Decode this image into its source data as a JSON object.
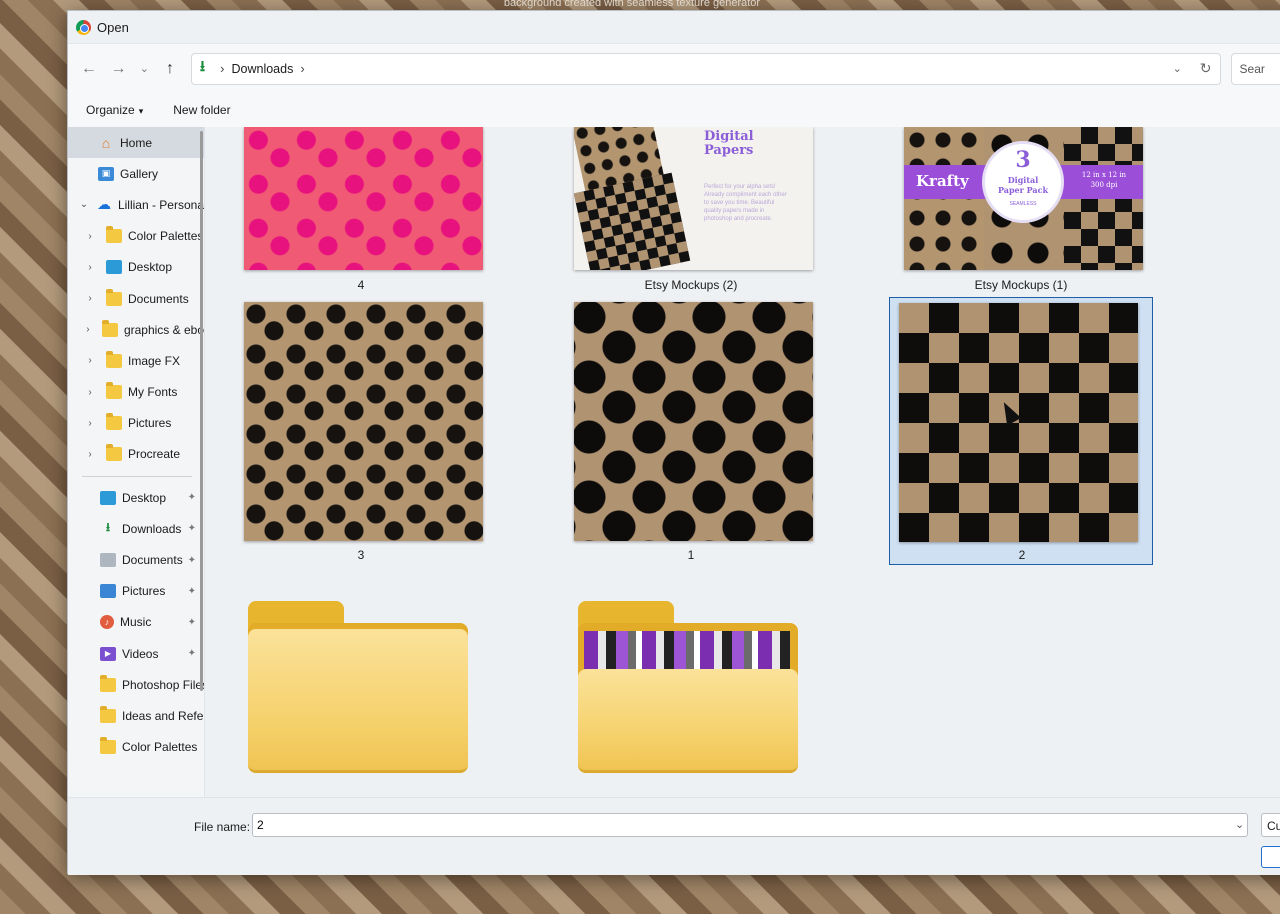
{
  "background_caption": "background created with seamless texture generator",
  "window": {
    "title": "Open"
  },
  "nav": {
    "back": "←",
    "forward": "→",
    "recent": "⌄",
    "up": "↑"
  },
  "address": {
    "icon": "download-icon",
    "path": [
      "Downloads"
    ],
    "separator": "›",
    "dropdown": "⌄",
    "refresh": "↻"
  },
  "search": {
    "placeholder": "Sear"
  },
  "toolbar": {
    "organize": "Organize",
    "organize_caret": "▾",
    "new_folder": "New folder"
  },
  "sidebar": {
    "items": [
      {
        "label": "Home",
        "icon": "home-icon",
        "indent": 0,
        "expander": "",
        "active": true
      },
      {
        "label": "Gallery",
        "icon": "gallery-icon",
        "indent": 0,
        "expander": ""
      },
      {
        "label": "Lillian - Persona",
        "icon": "onedrive-cloud-icon",
        "indent": 0,
        "expander": "⌄"
      },
      {
        "label": "Color Palettes",
        "icon": "folder-icon",
        "indent": 1,
        "expander": "›"
      },
      {
        "label": "Desktop",
        "icon": "desktop-icon",
        "indent": 1,
        "expander": "›"
      },
      {
        "label": "Documents",
        "icon": "folder-icon",
        "indent": 1,
        "expander": "›"
      },
      {
        "label": "graphics & ebo",
        "icon": "folder-icon",
        "indent": 1,
        "expander": "›"
      },
      {
        "label": "Image FX",
        "icon": "folder-icon",
        "indent": 1,
        "expander": "›"
      },
      {
        "label": "My Fonts",
        "icon": "folder-icon",
        "indent": 1,
        "expander": "›"
      },
      {
        "label": "Pictures",
        "icon": "folder-icon",
        "indent": 1,
        "expander": "›"
      },
      {
        "label": "Procreate",
        "icon": "folder-icon",
        "indent": 1,
        "expander": "›"
      }
    ],
    "quick_access": [
      {
        "label": "Desktop",
        "icon": "desktop-icon",
        "pinned": true
      },
      {
        "label": "Downloads",
        "icon": "download-icon",
        "pinned": true
      },
      {
        "label": "Documents",
        "icon": "documents-icon",
        "pinned": true
      },
      {
        "label": "Pictures",
        "icon": "pictures-icon",
        "pinned": true
      },
      {
        "label": "Music",
        "icon": "music-icon",
        "pinned": true
      },
      {
        "label": "Videos",
        "icon": "videos-icon",
        "pinned": true
      },
      {
        "label": "Photoshop Files",
        "icon": "folder-icon",
        "pinned": false
      },
      {
        "label": "Ideas and Refere",
        "icon": "folder-icon",
        "pinned": false
      },
      {
        "label": "Color Palettes",
        "icon": "folder-icon",
        "pinned": false
      }
    ],
    "pin_glyph": "📌"
  },
  "files": [
    {
      "name": "4",
      "kind": "image",
      "thumbnail": "pink-squiggle-pattern"
    },
    {
      "name": "Etsy Mockups (2)",
      "kind": "image",
      "thumbnail": "digital-papers-mockup",
      "thumb_text": {
        "title_line1": "Digital",
        "title_line2": "Papers",
        "blurb": "Perfect for your alpha sets! Already compliment each other to save you time. Beautiful quality papers made in photoshop and procreate."
      }
    },
    {
      "name": "Etsy Mockups (1)",
      "kind": "image",
      "thumbnail": "krafty-paper-pack-mockup",
      "thumb_text": {
        "brand": "Krafty",
        "number": "3",
        "pack_line1": "Digital",
        "pack_line2": "Paper Pack",
        "seamless": "SEAMLESS",
        "size_line1": "12 in x 12 in",
        "size_line2": "300 dpi"
      }
    },
    {
      "name": "3",
      "kind": "image",
      "thumbnail": "brown-leopard-pattern"
    },
    {
      "name": "1",
      "kind": "image",
      "thumbnail": "brown-polka-dot-pattern"
    },
    {
      "name": "2",
      "kind": "image",
      "thumbnail": "brown-checker-pattern",
      "selected": true
    },
    {
      "name": "",
      "kind": "folder",
      "thumbnail": "empty-folder"
    },
    {
      "name": "",
      "kind": "folder",
      "thumbnail": "folder-with-purple-brushstroke-preview"
    }
  ],
  "bottom": {
    "file_name_label": "File name:",
    "file_name_value": "2",
    "file_name_dropdown": "⌄",
    "filter_value": "Cu"
  },
  "colors": {
    "accent": "#1f5fa8",
    "selection_bg": "#cfe0f2",
    "folder_yellow": "#f6d370"
  }
}
